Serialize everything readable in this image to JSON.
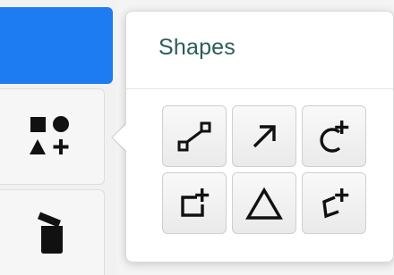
{
  "popover": {
    "title": "Shapes"
  },
  "toolbar": {
    "items": [
      {
        "icon": "active-tool-icon"
      },
      {
        "icon": "shapes-icon"
      },
      {
        "icon": "trash-icon"
      }
    ]
  },
  "shapes": [
    {
      "icon": "connector-line-icon"
    },
    {
      "icon": "arrow-icon"
    },
    {
      "icon": "add-circle-icon"
    },
    {
      "icon": "add-rectangle-icon"
    },
    {
      "icon": "triangle-icon"
    },
    {
      "icon": "add-polygon-icon"
    }
  ],
  "colors": {
    "accent": "#1e7cf2",
    "title": "#2b5d57",
    "icon": "#111111"
  }
}
